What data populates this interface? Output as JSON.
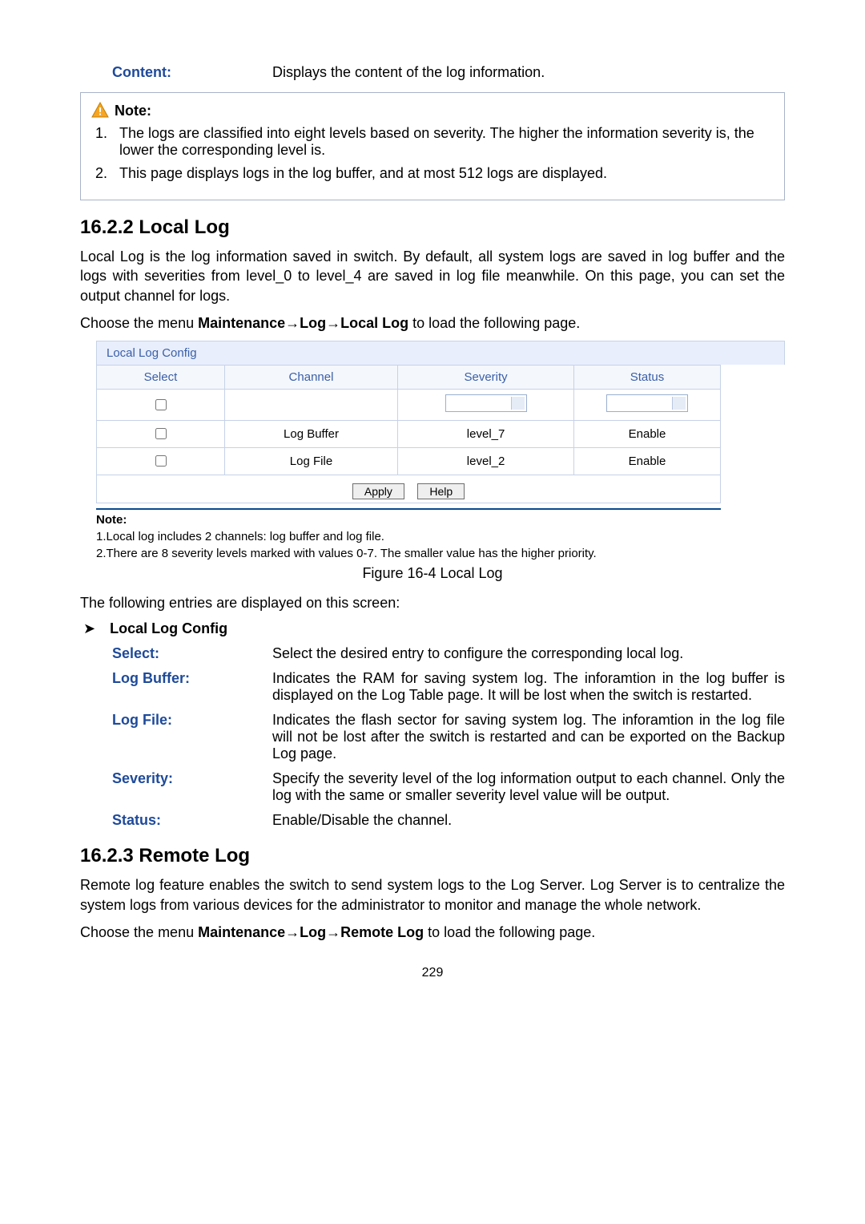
{
  "top": {
    "content_label": "Content:",
    "content_desc": "Displays the content of the log information."
  },
  "note1": {
    "header": "Note:",
    "items": [
      "The logs are classified into eight levels based on severity. The higher the information severity is, the lower the corresponding level is.",
      "This page displays logs in the log buffer, and at most 512 logs are displayed."
    ]
  },
  "section1": {
    "heading": "16.2.2  Local Log",
    "para1": "Local Log is the log information saved in switch. By default, all system logs are saved in log buffer and the logs with severities from level_0 to level_4 are saved in log file meanwhile. On this page, you can set the output channel for logs.",
    "menu_prefix": "Choose the menu ",
    "menu_bold": "Maintenance→Log→Local Log",
    "menu_suffix": " to load the following page.",
    "table": {
      "title": "Local Log Config",
      "headers": {
        "select": "Select",
        "channel": "Channel",
        "severity": "Severity",
        "status": "Status"
      },
      "rows": [
        {
          "channel": "Log Buffer",
          "severity": "level_7",
          "status": "Enable"
        },
        {
          "channel": "Log File",
          "severity": "level_2",
          "status": "Enable"
        }
      ],
      "buttons": {
        "apply": "Apply",
        "help": "Help"
      }
    },
    "figure_note_title": "Note:",
    "figure_notes": [
      "1.Local log includes 2 channels: log buffer and log file.",
      "2.There are 8 severity levels marked with values 0-7. The smaller value has the higher priority."
    ],
    "caption": "Figure 16-4 Local Log",
    "entries_intro": "The following entries are displayed on this screen:",
    "config_label": "Local Log Config",
    "defs": [
      {
        "term": "Select:",
        "def": "Select the desired entry to configure the corresponding local log."
      },
      {
        "term": "Log Buffer:",
        "def": "Indicates the RAM for saving system log. The inforamtion in the log buffer is displayed on the Log Table page. It will be lost when the switch is restarted."
      },
      {
        "term": "Log File:",
        "def": "Indicates the flash sector for saving system log. The inforamtion in the log file will not be lost after the switch is restarted and can be exported on the Backup Log page."
      },
      {
        "term": "Severity:",
        "def": "Specify the severity level of the log information output to each channel. Only the log with the same or smaller severity level value will be output."
      },
      {
        "term": "Status:",
        "def": "Enable/Disable the channel."
      }
    ]
  },
  "section2": {
    "heading": "16.2.3  Remote Log",
    "para1": "Remote log feature enables the switch to send system logs to the Log Server. Log Server is to centralize the system logs from various devices for the administrator to monitor and manage the whole network.",
    "menu_prefix": "Choose the menu ",
    "menu_bold": "Maintenance→Log→Remote Log",
    "menu_suffix": " to load the following page."
  },
  "page_number": "229"
}
